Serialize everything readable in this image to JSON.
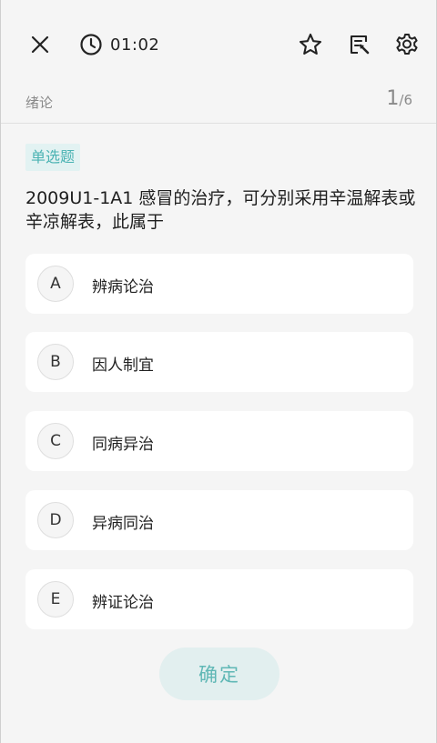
{
  "header": {
    "timer": "01:02",
    "icons": {
      "close": "close-icon",
      "clock": "clock-icon",
      "favorite": "star-icon",
      "answer_card": "edit-sheet-icon",
      "settings": "gear-icon"
    }
  },
  "chapter": {
    "name": "绪论",
    "current": "1",
    "total": "/6"
  },
  "question": {
    "type": "单选题",
    "text": "2009U1-1A1 感冒的治疗，可分别采用辛温解表或辛凉解表，此属于",
    "options": [
      {
        "letter": "A",
        "text": "辨病论治"
      },
      {
        "letter": "B",
        "text": "因人制宜"
      },
      {
        "letter": "C",
        "text": "同病异治"
      },
      {
        "letter": "D",
        "text": "异病同治"
      },
      {
        "letter": "E",
        "text": "辨证论治"
      }
    ]
  },
  "actions": {
    "confirm_label": "确定"
  },
  "colors": {
    "accent": "#4bb3b3",
    "accent_bg": "#e2f2f2",
    "page_bg": "#f5f5f5"
  }
}
